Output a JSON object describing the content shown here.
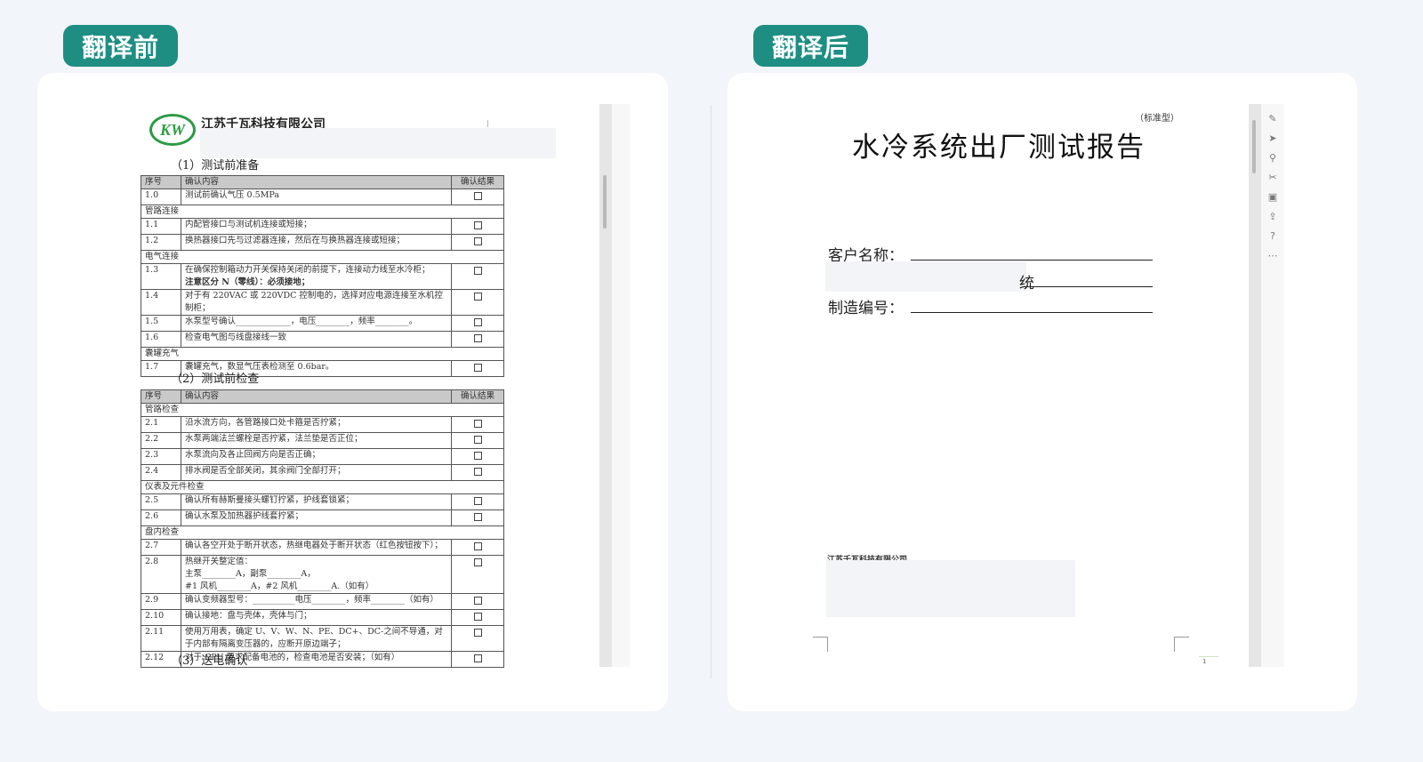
{
  "badges": {
    "before": "翻译前",
    "after": "翻译后"
  },
  "left_doc": {
    "logo_text": "KW",
    "company": "江苏千瓦科技有限公司",
    "section1_title": "（1）测试前准备",
    "section2_title": "（2）测试前检查",
    "section3_title": "（3）送电确认",
    "table1": {
      "headers": [
        "序号",
        "确认内容",
        "确认结果"
      ],
      "rows": [
        {
          "no": "1.0",
          "text": "测试前确认气压 0.5MPa",
          "check": true
        },
        {
          "group": "管路连接"
        },
        {
          "no": "1.1",
          "text": "内配管接口与测试机连接或短接；",
          "check": true
        },
        {
          "no": "1.2",
          "text": "换热器接口先与过滤器连接，然后在与换热器连接或短接；",
          "check": true
        },
        {
          "group": "电气连接"
        },
        {
          "no": "1.3",
          "text": "在确保控制箱动力开关保持关闭的前提下，连接动力线至水冷柜；",
          "text2": "注意区分 N（零线）：必须接地；",
          "check": true
        },
        {
          "no": "1.4",
          "text": "对于有 220VAC 或 220VDC 控制电的，选择对应电源连接至水机控",
          "text2": "制柜；",
          "check": true
        },
        {
          "no": "1.5",
          "text": "水泵型号确认_____________，电压________，频率________。",
          "check": true
        },
        {
          "no": "1.6",
          "text": "检查电气图与线盘接线一致",
          "check": true
        },
        {
          "group": "囊罐充气"
        },
        {
          "no": "1.7",
          "text": "囊罐充气，数显气压表检测至 0.6bar。",
          "check": true
        }
      ]
    },
    "table2": {
      "headers": [
        "序号",
        "确认内容",
        "确认结果"
      ],
      "rows": [
        {
          "group": "管路检查"
        },
        {
          "no": "2.1",
          "text": "沿水流方向，各管路接口处卡箍是否拧紧；",
          "check": true
        },
        {
          "no": "2.2",
          "text": "水泵两端法兰螺栓是否拧紧，法兰垫是否正位；",
          "check": true
        },
        {
          "no": "2.3",
          "text": "水泵流向及各止回阀方向是否正确；",
          "check": true
        },
        {
          "no": "2.4",
          "text": "排水阀是否全部关闭，其余阀门全部打开；",
          "check": true
        },
        {
          "group": "仪表及元件检查"
        },
        {
          "no": "2.5",
          "text": "确认所有赫斯曼接头螺钉拧紧，护线套锁紧；",
          "check": true
        },
        {
          "no": "2.6",
          "text": "确认水泵及加热器护线套拧紧；",
          "check": true
        },
        {
          "group": "盘内检查"
        },
        {
          "no": "2.7",
          "text": "确认各空开处于断开状态，热继电器处于断开状态（红色按钮按下）；",
          "check": true
        },
        {
          "no": "2.8",
          "text": "热继开关整定值：",
          "text2": "主泵________A，副泵________A，",
          "text3": "#1 风机________A，#2 风机________A.（如有）",
          "check": true
        },
        {
          "no": "2.9",
          "text": "确认变频器型号：__________电压________，频率________（如有）",
          "check": true
        },
        {
          "no": "2.10",
          "text": "确认接地：盘与壳体，壳体与门；",
          "check": true
        },
        {
          "no": "2.11",
          "text": "使用万用表，确定 U、V、W、N、PE、DC+、DC-之间不导通，对",
          "text2": "于内部有隔离变压器的，应断开原边端子；",
          "check": true
        },
        {
          "no": "2.12",
          "text": "对于 CPU 要求配备电池的，检查电池是否安装；（如有）",
          "check": true
        }
      ]
    }
  },
  "right_doc": {
    "std_type": "（标准型）",
    "title": "水冷系统出厂测试报告",
    "customer_label": "客户名称：",
    "partial_text": "统",
    "serial_label": "制造编号：",
    "company": "江苏千瓦科技有限公司",
    "page_number": "1"
  },
  "colors": {
    "badge": "#1e8e83",
    "background": "#f2f5fa",
    "logo_green": "#2d9a45"
  }
}
